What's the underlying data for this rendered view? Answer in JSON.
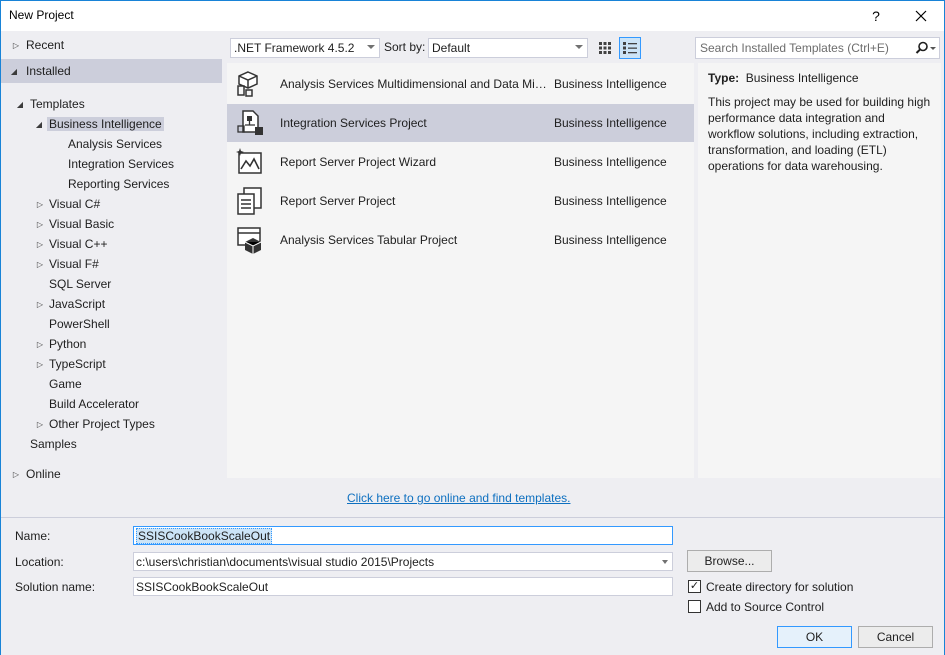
{
  "window": {
    "title": "New Project",
    "help_label": "?",
    "close_label": "✕"
  },
  "tree": [
    {
      "label": "Recent",
      "expander": "▷"
    },
    {
      "label": "Installed",
      "expander": "◢"
    },
    {
      "label": "Templates",
      "expander": "◢"
    },
    {
      "label": "Business Intelligence",
      "expander": "◢"
    },
    {
      "label": "Analysis Services",
      "expander": ""
    },
    {
      "label": "Integration Services",
      "expander": ""
    },
    {
      "label": "Reporting Services",
      "expander": ""
    },
    {
      "label": "Visual C#",
      "expander": "▷"
    },
    {
      "label": "Visual Basic",
      "expander": "▷"
    },
    {
      "label": "Visual C++",
      "expander": "▷"
    },
    {
      "label": "Visual F#",
      "expander": "▷"
    },
    {
      "label": "SQL Server",
      "expander": ""
    },
    {
      "label": "JavaScript",
      "expander": "▷"
    },
    {
      "label": "PowerShell",
      "expander": ""
    },
    {
      "label": "Python",
      "expander": "▷"
    },
    {
      "label": "TypeScript",
      "expander": "▷"
    },
    {
      "label": "Game",
      "expander": ""
    },
    {
      "label": "Build Accelerator",
      "expander": ""
    },
    {
      "label": "Other Project Types",
      "expander": "▷"
    },
    {
      "label": "Samples",
      "expander": ""
    },
    {
      "label": "Online",
      "expander": "▷"
    }
  ],
  "toolbar": {
    "framework": ".NET Framework 4.5.2",
    "sort_label": "Sort by:",
    "sort_value": "Default",
    "search_placeholder": "Search Installed Templates (Ctrl+E)"
  },
  "templates": [
    {
      "name": "Analysis Services Multidimensional and Data Mini...",
      "category": "Business Intelligence",
      "icon": "cube-icon"
    },
    {
      "name": "Integration Services Project",
      "category": "Business Intelligence",
      "icon": "integration-icon"
    },
    {
      "name": "Report Server Project Wizard",
      "category": "Business Intelligence",
      "icon": "report-wizard-icon"
    },
    {
      "name": "Report Server Project",
      "category": "Business Intelligence",
      "icon": "report-icon"
    },
    {
      "name": "Analysis Services Tabular Project",
      "category": "Business Intelligence",
      "icon": "tabular-icon"
    }
  ],
  "details": {
    "type_label": "Type:",
    "type_value": "Business Intelligence",
    "description": "This project may be used for building high performance data integration and workflow solutions, including extraction, transformation, and loading (ETL) operations for data warehousing."
  },
  "online_link": "Click here to go online and find templates.",
  "form": {
    "name_label": "Name:",
    "name_value": "SSISCookBookScaleOut",
    "location_label": "Location:",
    "location_value": "c:\\users\\christian\\documents\\visual studio 2015\\Projects",
    "solution_label": "Solution name:",
    "solution_value": "SSISCookBookScaleOut",
    "browse_label": "Browse...",
    "create_dir_label": "Create directory for solution",
    "create_dir_checked": "✓",
    "source_control_label": "Add to Source Control",
    "ok_label": "OK",
    "cancel_label": "Cancel"
  },
  "colors": {
    "accent": "#1883d7",
    "selection": "#cccedb",
    "link": "#0e70c0"
  }
}
